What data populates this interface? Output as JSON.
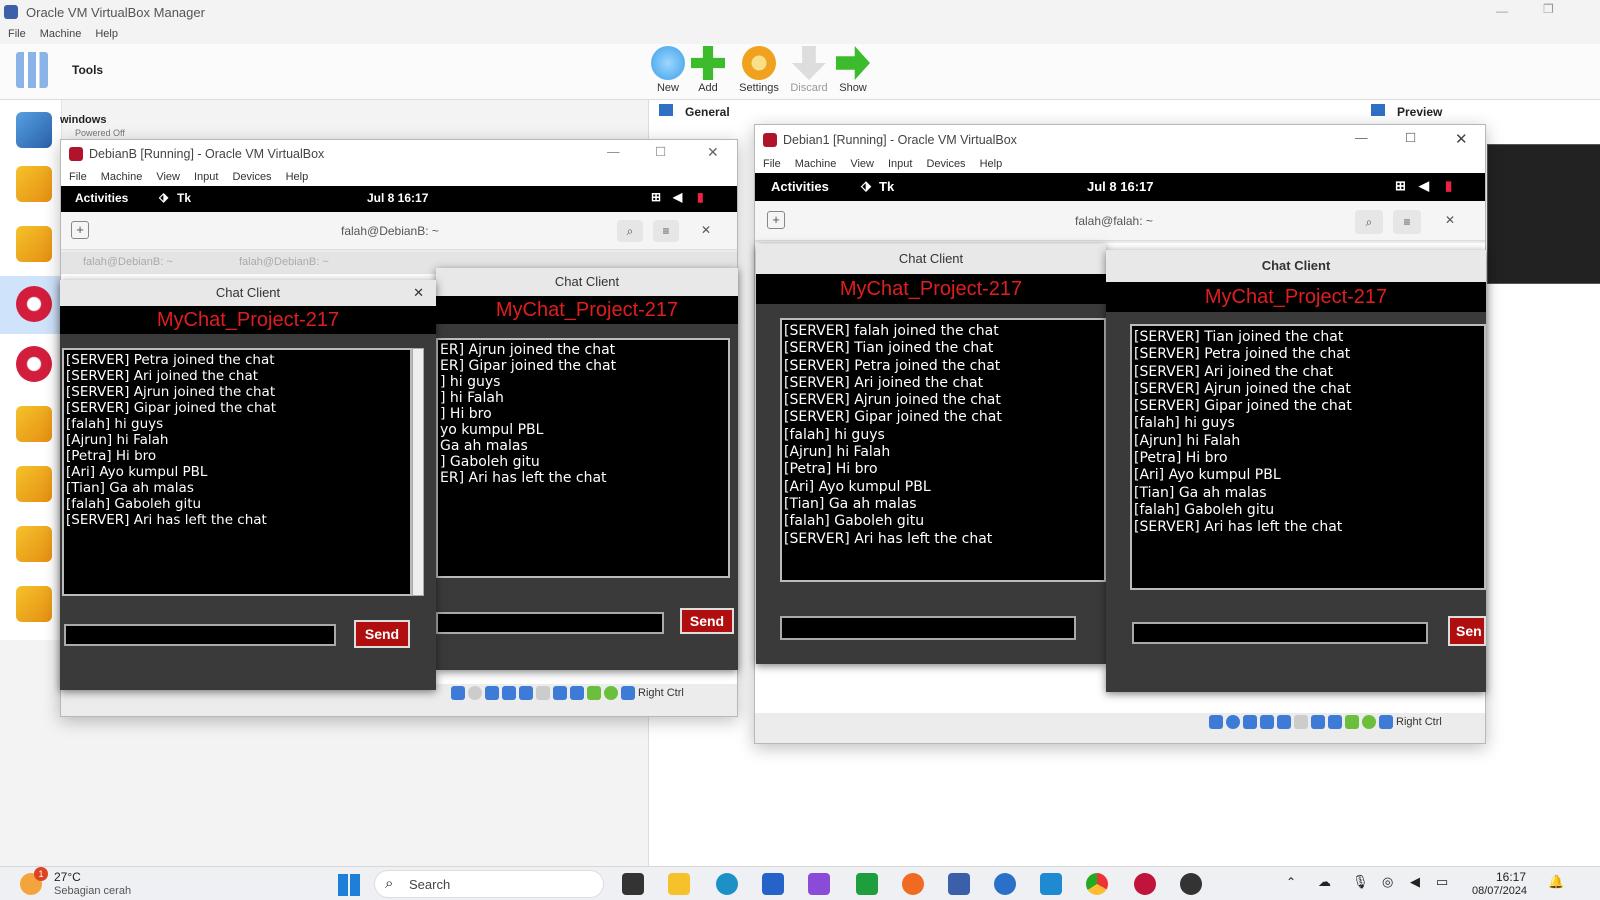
{
  "manager": {
    "title": "Oracle VM VirtualBox Manager",
    "menu": [
      "File",
      "Machine",
      "Help"
    ],
    "tools_label": "Tools",
    "toolbar": [
      {
        "label": "New",
        "color": "#3aa0e8"
      },
      {
        "label": "Add",
        "color": "#3cbc2c"
      },
      {
        "label": "Settings",
        "color": "#f0a21e"
      },
      {
        "label": "Discard",
        "color": "#c8c8c8"
      },
      {
        "label": "Show",
        "color": "#3cbc2c"
      }
    ],
    "vm_first_name": "windows",
    "vm_first_state": "Powered Off",
    "general_label": "General",
    "preview_label": "Preview"
  },
  "win_b": {
    "title": "DebianB [Running] - Oracle VM VirtualBox",
    "menu": [
      "File",
      "Machine",
      "View",
      "Input",
      "Devices",
      "Help"
    ],
    "activities": "Activities",
    "app": "Tk",
    "clock": "Jul 8  16:17",
    "terminal_title": "falah@DebianB: ~",
    "tabs": [
      "falah@DebianB: ~",
      "falah@DebianB: ~"
    ],
    "host_key": "Right Ctrl"
  },
  "win_1": {
    "title": "Debian1 [Running] - Oracle VM VirtualBox",
    "menu": [
      "File",
      "Machine",
      "View",
      "Input",
      "Devices",
      "Help"
    ],
    "activities": "Activities",
    "app": "Tk",
    "clock": "Jul 8  16:17",
    "terminal_title": "falah@falah: ~",
    "host_key": "Right Ctrl"
  },
  "chats": {
    "b_front": {
      "window_title": "Chat Client",
      "heading": "MyChat_Project-217",
      "send": "Send",
      "messages": [
        "[SERVER] Petra joined the chat",
        "[SERVER] Ari joined the chat",
        "[SERVER] Ajrun joined the chat",
        "[SERVER] Gipar joined the chat",
        "[falah] hi guys",
        "[Ajrun] hi Falah",
        "[Petra] Hi bro",
        "[Ari] Ayo kumpul PBL",
        "[Tian] Ga ah malas",
        "[falah] Gaboleh gitu",
        "[SERVER] Ari has left the chat"
      ]
    },
    "b_back": {
      "window_title": "Chat Client",
      "heading": "MyChat_Project-217",
      "send": "Send",
      "messages": [
        "ER] Ajrun joined the chat",
        "ER] Gipar joined the chat",
        "] hi guys",
        "] hi Falah",
        "] Hi bro",
        "yo kumpul PBL",
        "Ga ah malas",
        "] Gaboleh gitu",
        "ER] Ari has left the chat"
      ]
    },
    "d1_left": {
      "window_title": "Chat Client",
      "heading": "MyChat_Project-217",
      "messages": [
        "[SERVER] falah joined the chat",
        "[SERVER] Tian joined the chat",
        "[SERVER] Petra joined the chat",
        "[SERVER] Ari joined the chat",
        "[SERVER] Ajrun joined the chat",
        "[SERVER] Gipar joined the chat",
        "[falah] hi guys",
        "[Ajrun] hi Falah",
        "[Petra] Hi bro",
        "[Ari] Ayo kumpul PBL",
        "[Tian] Ga ah malas",
        "[falah] Gaboleh gitu",
        "[SERVER] Ari has left the chat"
      ]
    },
    "d1_right": {
      "window_title": "Chat Client",
      "heading": "MyChat_Project-217",
      "send": "Sen",
      "messages": [
        "[SERVER] Tian joined the chat",
        "[SERVER] Petra joined the chat",
        "[SERVER] Ari joined the chat",
        "[SERVER] Ajrun joined the chat",
        "[SERVER] Gipar joined the chat",
        "[falah] hi guys",
        "[Ajrun] hi Falah",
        "[Petra] Hi bro",
        "[Ari] Ayo kumpul PBL",
        "[Tian] Ga ah malas",
        "[falah] Gaboleh gitu",
        "[SERVER] Ari has left the chat"
      ]
    }
  },
  "taskbar": {
    "temperature": "27°C",
    "weather": "Sebagian cerah",
    "search": "Search",
    "time": "16:17",
    "date": "08/07/2024",
    "notif_count": "1"
  },
  "colors": {
    "chat_heading": "#e01e1e",
    "send_button": "#b10f0f"
  }
}
